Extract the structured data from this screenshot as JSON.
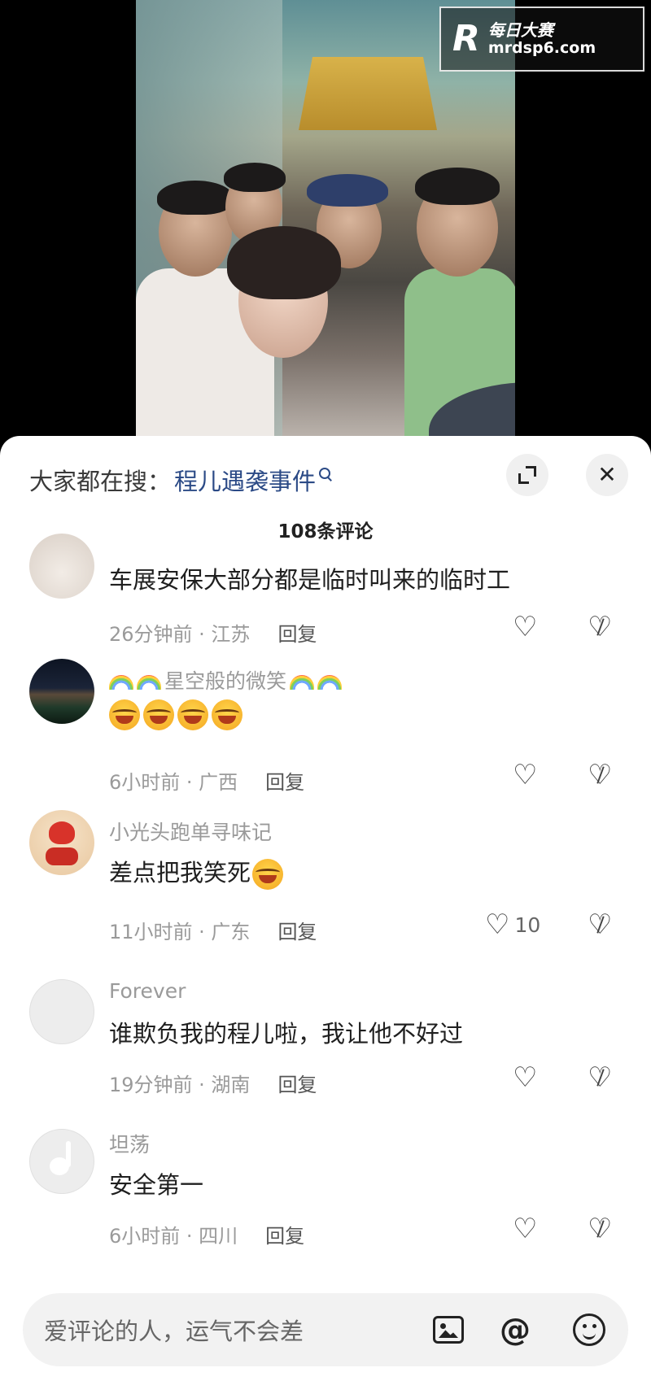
{
  "watermark": {
    "logo": "R",
    "brand": "每日大赛",
    "url": "mrdsp6.com"
  },
  "search": {
    "prefix": "大家都在搜：",
    "term": "程儿遇袭事件"
  },
  "comments_header": {
    "count_label": "108条评论"
  },
  "comments": [
    {
      "nickname": "",
      "content": "车展安保大部分都是临时叫来的临时工",
      "time": "26分钟前 · 江苏",
      "reply": "回复",
      "likes": ""
    },
    {
      "nickname": "星空般的微笑",
      "content": "",
      "time": "6小时前 · 广西",
      "reply": "回复",
      "likes": ""
    },
    {
      "nickname": "小光头跑单寻味记",
      "content": "差点把我笑死",
      "time": "11小时前 · 广东",
      "reply": "回复",
      "likes": "10"
    },
    {
      "nickname": "Forever",
      "content": "谁欺负我的程儿啦，我让他不好过",
      "time": "19分钟前 · 湖南",
      "reply": "回复",
      "likes": ""
    },
    {
      "nickname": "坦荡",
      "content": "安全第一",
      "time": "6小时前 · 四川",
      "reply": "回复",
      "likes": ""
    }
  ],
  "input": {
    "placeholder": "爱评论的人，运气不会差"
  },
  "icons": {
    "like": "heart-outline",
    "dislike": "broken-heart-outline",
    "expand": "expand-icon",
    "close": "close-icon",
    "image": "image-icon",
    "mention": "at-icon",
    "emoji": "smile-icon"
  }
}
